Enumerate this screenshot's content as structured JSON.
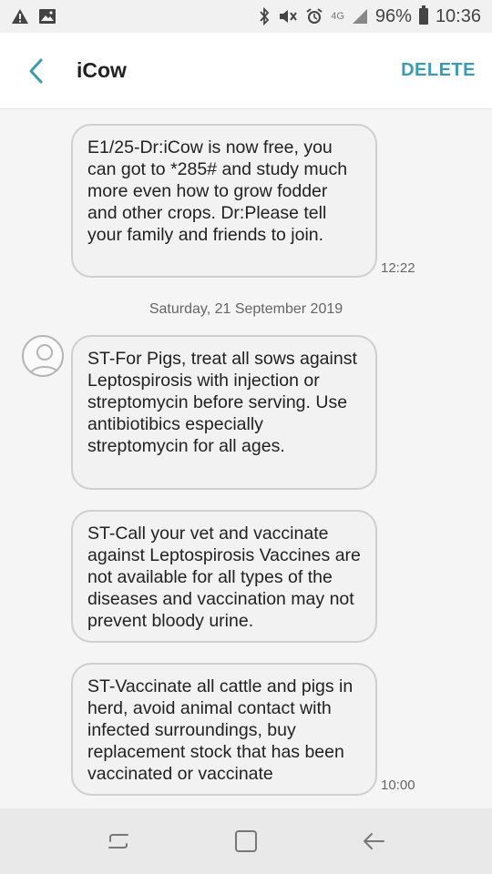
{
  "status_bar": {
    "network": "4G",
    "battery": "96%",
    "time": "10:36",
    "icons": [
      "warning-icon",
      "image-icon",
      "bluetooth-icon",
      "mute-icon",
      "alarm-icon",
      "signal-icon",
      "battery-icon"
    ]
  },
  "app_bar": {
    "title": "iCow",
    "delete_label": "DELETE",
    "accent_color": "#3c9bb4"
  },
  "messages": {
    "msg1": {
      "text": "E1/25-Dr:iCow is now free, you can got to *285# and study much more even how to grow fodder and other crops. Dr:Please tell your family and friends to join.",
      "time": "12:22"
    },
    "date_separator": "Saturday, 21 September 2019",
    "msg2": {
      "text": "ST-For Pigs, treat all sows against Leptospirosis with injection or streptomycin before serving. Use antibiotibics especially streptomycin for all ages."
    },
    "msg3": {
      "text": "ST-Call your vet and vaccinate against Leptospirosis Vaccines are not available for all types of the diseases and vaccination may not prevent bloody urine."
    },
    "msg4": {
      "text": "ST-Vaccinate all cattle and pigs in herd, avoid animal contact with infected surroundings, buy replacement stock that has been vaccinated or vaccinate",
      "time": "10:00"
    }
  },
  "nav_bar": {
    "icons": [
      "recent-apps-icon",
      "home-icon",
      "back-icon"
    ]
  }
}
